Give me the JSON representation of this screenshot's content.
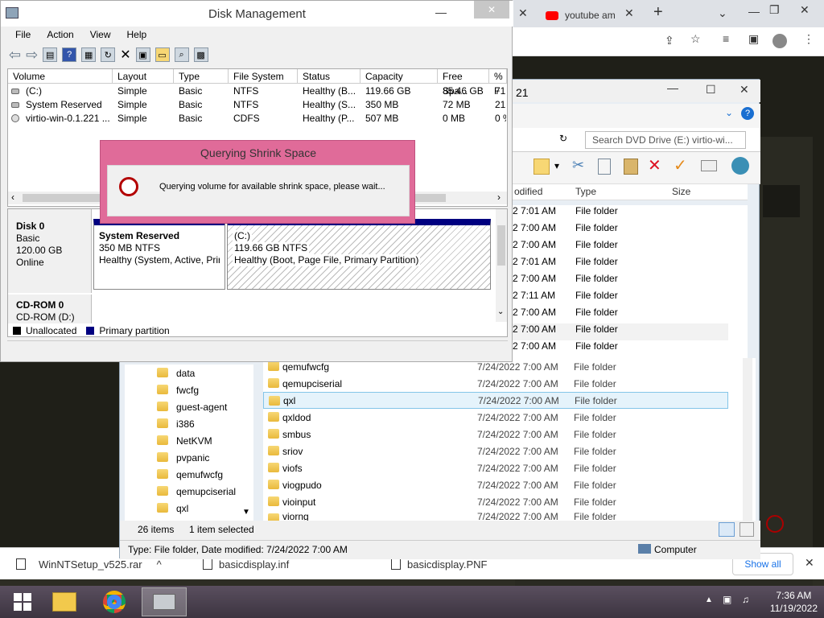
{
  "chrome": {
    "tab_title": "youtube am",
    "downloads": [
      {
        "name": "WinNTSetup_v525.rar"
      },
      {
        "name": "basicdisplay.inf"
      },
      {
        "name": "basicdisplay.PNF"
      }
    ],
    "show_all": "Show all"
  },
  "explorer": {
    "title_partial": "21",
    "search_placeholder": "Search DVD Drive (E:) virtio-wi...",
    "columns": {
      "modified": "odified",
      "type": "Type",
      "size": "Size"
    },
    "tree": [
      "data",
      "fwcfg",
      "guest-agent",
      "i386",
      "NetKVM",
      "pvpanic",
      "qemufwcfg",
      "qemupciserial",
      "qxl"
    ],
    "top_rows": [
      {
        "date": "2 7:01 AM",
        "type": "File folder"
      },
      {
        "date": "2 7:00 AM",
        "type": "File folder"
      },
      {
        "date": "2 7:00 AM",
        "type": "File folder"
      },
      {
        "date": "2 7:01 AM",
        "type": "File folder"
      },
      {
        "date": "2 7:00 AM",
        "type": "File folder"
      },
      {
        "date": "2 7:11 AM",
        "type": "File folder"
      },
      {
        "date": "2 7:00 AM",
        "type": "File folder"
      },
      {
        "date": "2 7:00 AM",
        "type": "File folder"
      },
      {
        "date": "2 7:00 AM",
        "type": "File folder"
      }
    ],
    "files": [
      {
        "name": "qemufwcfg",
        "date": "7/24/2022 7:00 AM",
        "type": "File folder"
      },
      {
        "name": "qemupciserial",
        "date": "7/24/2022 7:00 AM",
        "type": "File folder"
      },
      {
        "name": "qxl",
        "date": "7/24/2022 7:00 AM",
        "type": "File folder"
      },
      {
        "name": "qxldod",
        "date": "7/24/2022 7:00 AM",
        "type": "File folder"
      },
      {
        "name": "smbus",
        "date": "7/24/2022 7:00 AM",
        "type": "File folder"
      },
      {
        "name": "sriov",
        "date": "7/24/2022 7:00 AM",
        "type": "File folder"
      },
      {
        "name": "viofs",
        "date": "7/24/2022 7:00 AM",
        "type": "File folder"
      },
      {
        "name": "viogpudo",
        "date": "7/24/2022 7:00 AM",
        "type": "File folder"
      },
      {
        "name": "vioinput",
        "date": "7/24/2022 7:00 AM",
        "type": "File folder"
      },
      {
        "name": "viorng",
        "date": "7/24/2022 7:00 AM",
        "type": "File folder"
      }
    ],
    "item_count": "26 items",
    "selected": "1 item selected",
    "details": "Type: File folder, Date modified: 7/24/2022 7:00 AM",
    "location": "Computer"
  },
  "disk_management": {
    "title": "Disk Management",
    "menu": [
      "File",
      "Action",
      "View",
      "Help"
    ],
    "columns": [
      "Volume",
      "Layout",
      "Type",
      "File System",
      "Status",
      "Capacity",
      "Free Spa...",
      "% F"
    ],
    "volumes": [
      {
        "volume": "(C:)",
        "layout": "Simple",
        "type": "Basic",
        "fs": "NTFS",
        "status": "Healthy (B...",
        "capacity": "119.66 GB",
        "free": "85.46 GB",
        "pct": "71"
      },
      {
        "volume": "System Reserved",
        "layout": "Simple",
        "type": "Basic",
        "fs": "NTFS",
        "status": "Healthy (S...",
        "capacity": "350 MB",
        "free": "72 MB",
        "pct": "21"
      },
      {
        "volume": "virtio-win-0.1.221 ...",
        "layout": "Simple",
        "type": "Basic",
        "fs": "CDFS",
        "status": "Healthy (P...",
        "capacity": "507 MB",
        "free": "0 MB",
        "pct": "0 %"
      }
    ],
    "disk0": {
      "name": "Disk 0",
      "type": "Basic",
      "size": "120.00 GB",
      "state": "Online"
    },
    "cdrom": {
      "name": "CD-ROM 0",
      "drive": "CD-ROM (D:)"
    },
    "sys_part": {
      "name": "System Reserved",
      "size": "350 MB NTFS",
      "status": "Healthy (System, Active, Prir"
    },
    "c_part": {
      "name": "(C:)",
      "size": "119.66 GB NTFS",
      "status": "Healthy (Boot, Page File, Primary Partition)"
    },
    "legend": {
      "unallocated": "Unallocated",
      "primary": "Primary partition",
      "unalloc_color": "#000000",
      "primary_color": "#000080"
    }
  },
  "dialog": {
    "title": "Querying Shrink Space",
    "message": "Querying volume for available shrink space, please wait...",
    "accent": "#e06b99"
  },
  "taskbar": {
    "time": "7:36 AM",
    "date": "11/19/2022"
  }
}
